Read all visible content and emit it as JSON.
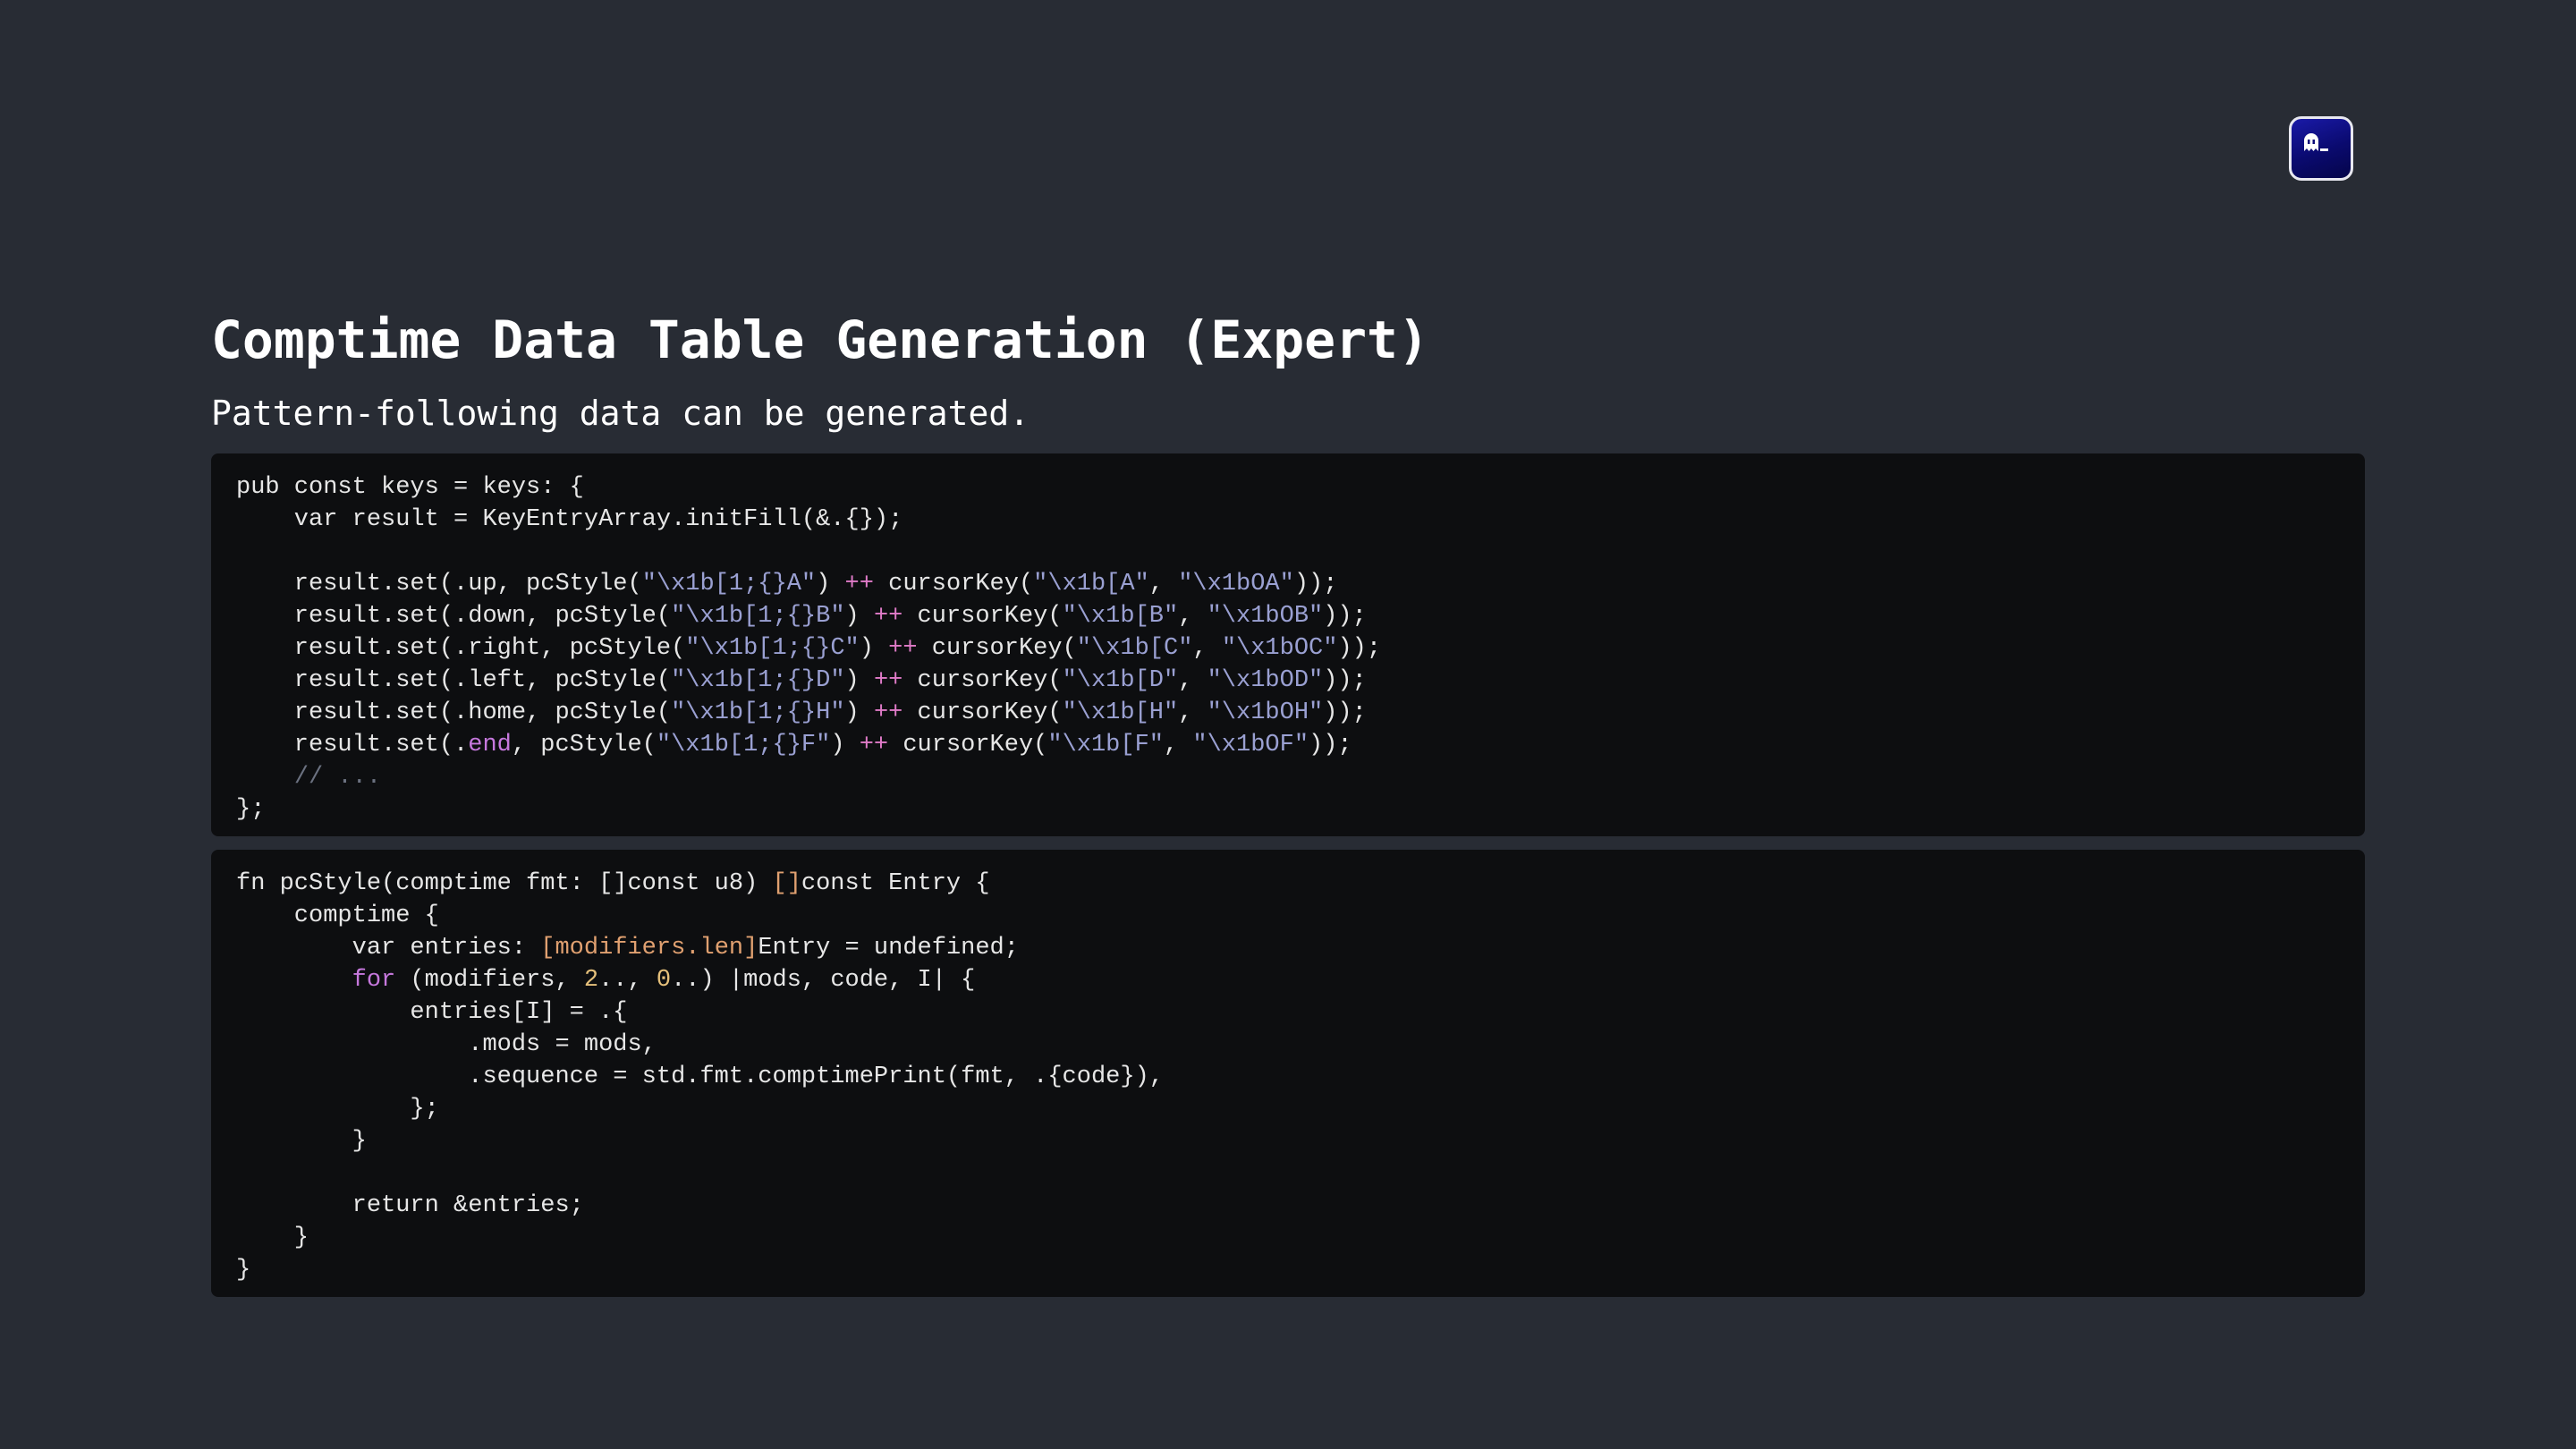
{
  "slide": {
    "title": "Comptime Data Table Generation (Expert)",
    "subtitle": "Pattern-following data can be generated."
  },
  "app_icon": {
    "icon": "ghost-terminal-icon",
    "colors": {
      "background": "#0a0a7a",
      "border": "#e8e8f0",
      "glyph": "#ffffff"
    }
  },
  "colors": {
    "background": "#282c34",
    "code_background": "#0d0e10",
    "text": "#e6e6e6",
    "string": "#9aa0d2",
    "operator": "#e07bc8",
    "keyword": "#c678dd",
    "number": "#e5c07b",
    "bracket": "#e0a070",
    "comment": "#6b7180"
  },
  "code_blocks": [
    {
      "lines": [
        [
          {
            "t": "pub const keys = keys: {"
          }
        ],
        [
          {
            "t": "    var result = KeyEntryArray.initFill(&.{});"
          }
        ],
        [
          {
            "t": ""
          }
        ],
        [
          {
            "t": "    result.set(.up, pcStyle("
          },
          {
            "t": "\"\\x1b[1;{}A\"",
            "c": "str"
          },
          {
            "t": ") "
          },
          {
            "t": "++",
            "c": "op"
          },
          {
            "t": " cursorKey("
          },
          {
            "t": "\"\\x1b[A\"",
            "c": "str"
          },
          {
            "t": ", "
          },
          {
            "t": "\"\\x1bOA\"",
            "c": "str"
          },
          {
            "t": "));"
          }
        ],
        [
          {
            "t": "    result.set(.down, pcStyle("
          },
          {
            "t": "\"\\x1b[1;{}B\"",
            "c": "str"
          },
          {
            "t": ") "
          },
          {
            "t": "++",
            "c": "op"
          },
          {
            "t": " cursorKey("
          },
          {
            "t": "\"\\x1b[B\"",
            "c": "str"
          },
          {
            "t": ", "
          },
          {
            "t": "\"\\x1bOB\"",
            "c": "str"
          },
          {
            "t": "));"
          }
        ],
        [
          {
            "t": "    result.set(.right, pcStyle("
          },
          {
            "t": "\"\\x1b[1;{}C\"",
            "c": "str"
          },
          {
            "t": ") "
          },
          {
            "t": "++",
            "c": "op"
          },
          {
            "t": " cursorKey("
          },
          {
            "t": "\"\\x1b[C\"",
            "c": "str"
          },
          {
            "t": ", "
          },
          {
            "t": "\"\\x1bOC\"",
            "c": "str"
          },
          {
            "t": "));"
          }
        ],
        [
          {
            "t": "    result.set(.left, pcStyle("
          },
          {
            "t": "\"\\x1b[1;{}D\"",
            "c": "str"
          },
          {
            "t": ") "
          },
          {
            "t": "++",
            "c": "op"
          },
          {
            "t": " cursorKey("
          },
          {
            "t": "\"\\x1b[D\"",
            "c": "str"
          },
          {
            "t": ", "
          },
          {
            "t": "\"\\x1bOD\"",
            "c": "str"
          },
          {
            "t": "));"
          }
        ],
        [
          {
            "t": "    result.set(.home, pcStyle("
          },
          {
            "t": "\"\\x1b[1;{}H\"",
            "c": "str"
          },
          {
            "t": ") "
          },
          {
            "t": "++",
            "c": "op"
          },
          {
            "t": " cursorKey("
          },
          {
            "t": "\"\\x1b[H\"",
            "c": "str"
          },
          {
            "t": ", "
          },
          {
            "t": "\"\\x1bOH\"",
            "c": "str"
          },
          {
            "t": "));"
          }
        ],
        [
          {
            "t": "    result.set(."
          },
          {
            "t": "end",
            "c": "kw"
          },
          {
            "t": ", pcStyle("
          },
          {
            "t": "\"\\x1b[1;{}F\"",
            "c": "str"
          },
          {
            "t": ") "
          },
          {
            "t": "++",
            "c": "op"
          },
          {
            "t": " cursorKey("
          },
          {
            "t": "\"\\x1b[F\"",
            "c": "str"
          },
          {
            "t": ", "
          },
          {
            "t": "\"\\x1bOF\"",
            "c": "str"
          },
          {
            "t": "));"
          }
        ],
        [
          {
            "t": "    "
          },
          {
            "t": "// ...",
            "c": "cm"
          }
        ],
        [
          {
            "t": "};"
          }
        ]
      ]
    },
    {
      "lines": [
        [
          {
            "t": "fn pcStyle(comptime fmt: []const u8) "
          },
          {
            "t": "[]",
            "c": "br"
          },
          {
            "t": "const Entry {"
          }
        ],
        [
          {
            "t": "    comptime {"
          }
        ],
        [
          {
            "t": "        var entries: "
          },
          {
            "t": "[modifiers.len]",
            "c": "br"
          },
          {
            "t": "Entry = undefined;"
          }
        ],
        [
          {
            "t": "        "
          },
          {
            "t": "for",
            "c": "kw"
          },
          {
            "t": " (modifiers, "
          },
          {
            "t": "2",
            "c": "num"
          },
          {
            "t": ".., "
          },
          {
            "t": "0",
            "c": "num"
          },
          {
            "t": "..) |mods, code, I| {"
          }
        ],
        [
          {
            "t": "            entries[I] = .{"
          }
        ],
        [
          {
            "t": "                .mods = mods,"
          }
        ],
        [
          {
            "t": "                .sequence = std.fmt.comptimePrint(fmt, .{code}),"
          }
        ],
        [
          {
            "t": "            };"
          }
        ],
        [
          {
            "t": "        }"
          }
        ],
        [
          {
            "t": ""
          }
        ],
        [
          {
            "t": "        return &entries;"
          }
        ],
        [
          {
            "t": "    }"
          }
        ],
        [
          {
            "t": "}"
          }
        ]
      ]
    }
  ]
}
